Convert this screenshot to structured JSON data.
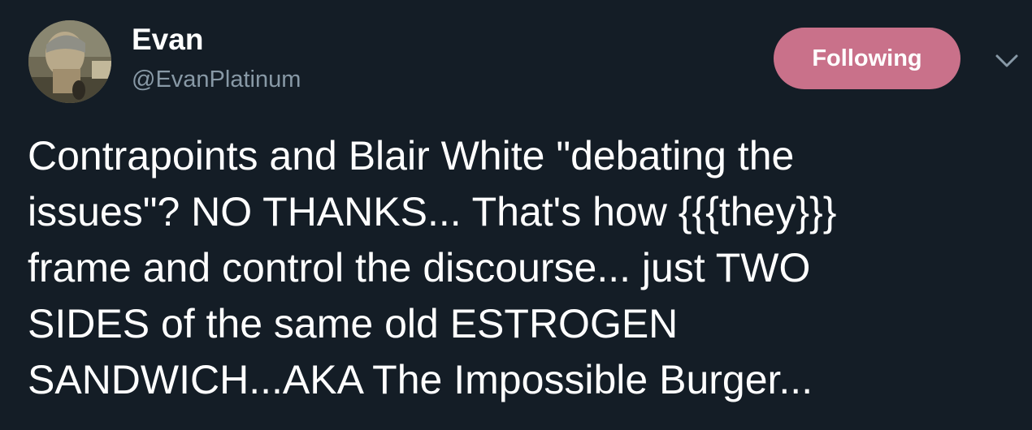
{
  "tweet": {
    "author_name": "Evan",
    "author_handle": "@EvanPlatinum",
    "follow_label": "Following",
    "avatar_icon": "profile-photo",
    "caret_icon": "chevron-down-icon",
    "follow_color": "#c9718a",
    "background_color": "#141d26",
    "text": "Contrapoints and Blair White \"debating the\nissues\"? NO THANKS... That's how {{{they}}}\nframe and control the discourse... just TWO\nSIDES of the same old ESTROGEN\nSANDWICH...AKA The Impossible Burger..."
  }
}
